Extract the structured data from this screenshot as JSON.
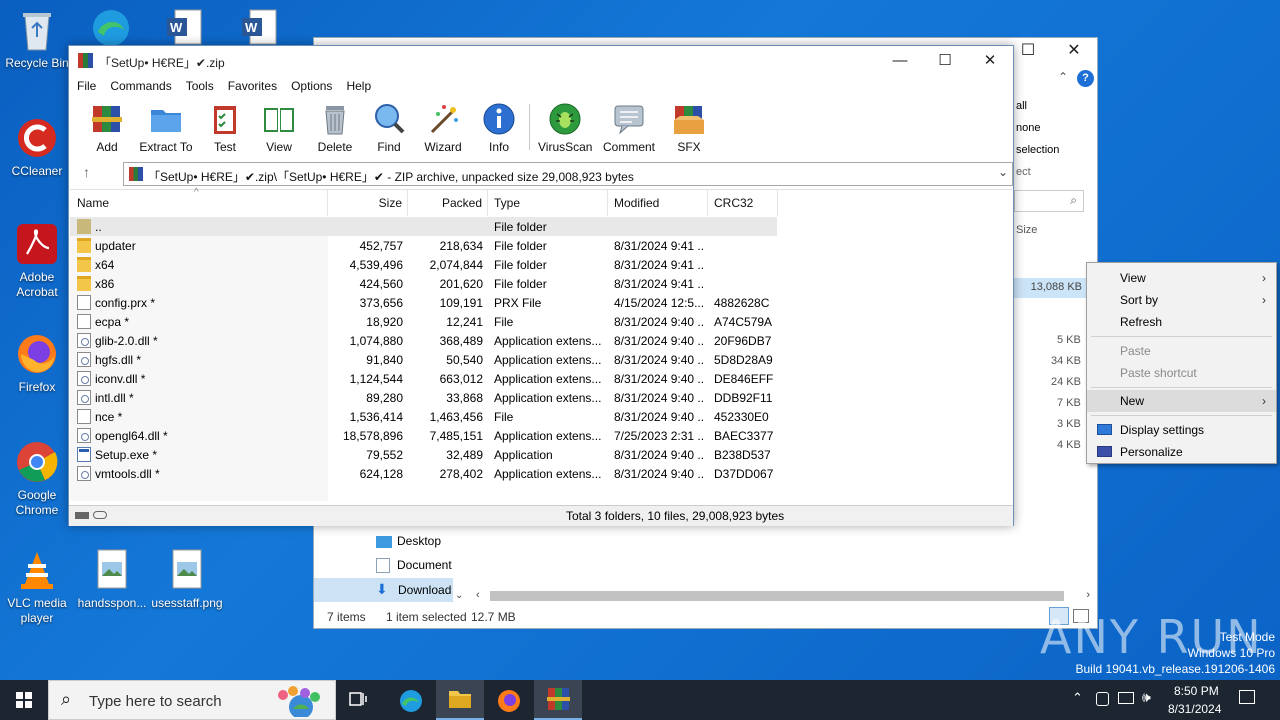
{
  "desktop": {
    "icons": [
      {
        "label": "Recycle Bin"
      },
      {
        "label": "CCleaner"
      },
      {
        "label": "Adobe Acrobat"
      },
      {
        "label": "Firefox"
      },
      {
        "label": "Google Chrome"
      },
      {
        "label": "VLC media player"
      },
      {
        "label": "handsspon..."
      },
      {
        "label": "usesstaff.png"
      }
    ]
  },
  "explorer": {
    "right_labels": [
      "all",
      "none",
      "selection",
      "ect"
    ],
    "size_header": "Size",
    "size_selected": "13,088 KB",
    "sizes": [
      "5 KB",
      "34 KB",
      "24 KB",
      "7 KB",
      "3 KB",
      "4 KB"
    ],
    "nav": [
      "Desktop",
      "Document",
      "Download"
    ],
    "status_items": "7 items",
    "status_selected": "1 item selected",
    "status_size": "12.7 MB"
  },
  "context_menu": {
    "view": "View",
    "sort_by": "Sort by",
    "refresh": "Refresh",
    "paste": "Paste",
    "paste_shortcut": "Paste shortcut",
    "new": "New",
    "display_settings": "Display settings",
    "personalize": "Personalize"
  },
  "rar": {
    "title": "「SetUp• H€RE」✔.zip",
    "menu": [
      "File",
      "Commands",
      "Tools",
      "Favorites",
      "Options",
      "Help"
    ],
    "toolbar": [
      "Add",
      "Extract To",
      "Test",
      "View",
      "Delete",
      "Find",
      "Wizard",
      "Info",
      "VirusScan",
      "Comment",
      "SFX"
    ],
    "address": "「SetUp• H€RE」✔.zip\\「SetUp• H€RE」✔ - ZIP archive, unpacked size 29,008,923 bytes",
    "columns": {
      "name": "Name",
      "size": "Size",
      "packed": "Packed",
      "type": "Type",
      "modified": "Modified",
      "crc": "CRC32"
    },
    "rows": [
      {
        "icon": "up",
        "name": "..",
        "size": "",
        "packed": "",
        "type": "File folder",
        "modified": "",
        "crc": ""
      },
      {
        "icon": "folder",
        "name": "updater",
        "size": "452,757",
        "packed": "218,634",
        "type": "File folder",
        "modified": "8/31/2024 9:41 ...",
        "crc": ""
      },
      {
        "icon": "folder",
        "name": "x64",
        "size": "4,539,496",
        "packed": "2,074,844",
        "type": "File folder",
        "modified": "8/31/2024 9:41 ...",
        "crc": ""
      },
      {
        "icon": "folder",
        "name": "x86",
        "size": "424,560",
        "packed": "201,620",
        "type": "File folder",
        "modified": "8/31/2024 9:41 ...",
        "crc": ""
      },
      {
        "icon": "file",
        "name": "config.prx *",
        "size": "373,656",
        "packed": "109,191",
        "type": "PRX File",
        "modified": "4/15/2024 12:5...",
        "crc": "4882628C"
      },
      {
        "icon": "file",
        "name": "ecpa *",
        "size": "18,920",
        "packed": "12,241",
        "type": "File",
        "modified": "8/31/2024 9:40 ...",
        "crc": "A74C579A"
      },
      {
        "icon": "dll",
        "name": "glib-2.0.dll *",
        "size": "1,074,880",
        "packed": "368,489",
        "type": "Application extens...",
        "modified": "8/31/2024 9:40 ...",
        "crc": "20F96DB7"
      },
      {
        "icon": "dll",
        "name": "hgfs.dll *",
        "size": "91,840",
        "packed": "50,540",
        "type": "Application extens...",
        "modified": "8/31/2024 9:40 ...",
        "crc": "5D8D28A9"
      },
      {
        "icon": "dll",
        "name": "iconv.dll *",
        "size": "1,124,544",
        "packed": "663,012",
        "type": "Application extens...",
        "modified": "8/31/2024 9:40 ...",
        "crc": "DE846EFF"
      },
      {
        "icon": "dll",
        "name": "intl.dll *",
        "size": "89,280",
        "packed": "33,868",
        "type": "Application extens...",
        "modified": "8/31/2024 9:40 ...",
        "crc": "DDB92F11"
      },
      {
        "icon": "file",
        "name": "nce *",
        "size": "1,536,414",
        "packed": "1,463,456",
        "type": "File",
        "modified": "8/31/2024 9:40 ...",
        "crc": "452330E0"
      },
      {
        "icon": "dll",
        "name": "opengl64.dll *",
        "size": "18,578,896",
        "packed": "7,485,151",
        "type": "Application extens...",
        "modified": "7/25/2023 2:31 ...",
        "crc": "BAEC3377"
      },
      {
        "icon": "exe",
        "name": "Setup.exe *",
        "size": "79,552",
        "packed": "32,489",
        "type": "Application",
        "modified": "8/31/2024 9:40 ...",
        "crc": "B238D537"
      },
      {
        "icon": "dll",
        "name": "vmtools.dll *",
        "size": "624,128",
        "packed": "278,402",
        "type": "Application extens...",
        "modified": "8/31/2024 9:40 ...",
        "crc": "D37DD067"
      }
    ],
    "status": "Total 3 folders, 10 files, 29,008,923 bytes"
  },
  "taskbar": {
    "search_placeholder": "Type here to search",
    "time": "8:50 PM",
    "date": "8/31/2024"
  },
  "watermark": {
    "brand": "ANY RUN",
    "line1": "Test Mode",
    "line2": "Windows 10 Pro",
    "line3": "Build 19041.vb_release.191206-1406"
  }
}
